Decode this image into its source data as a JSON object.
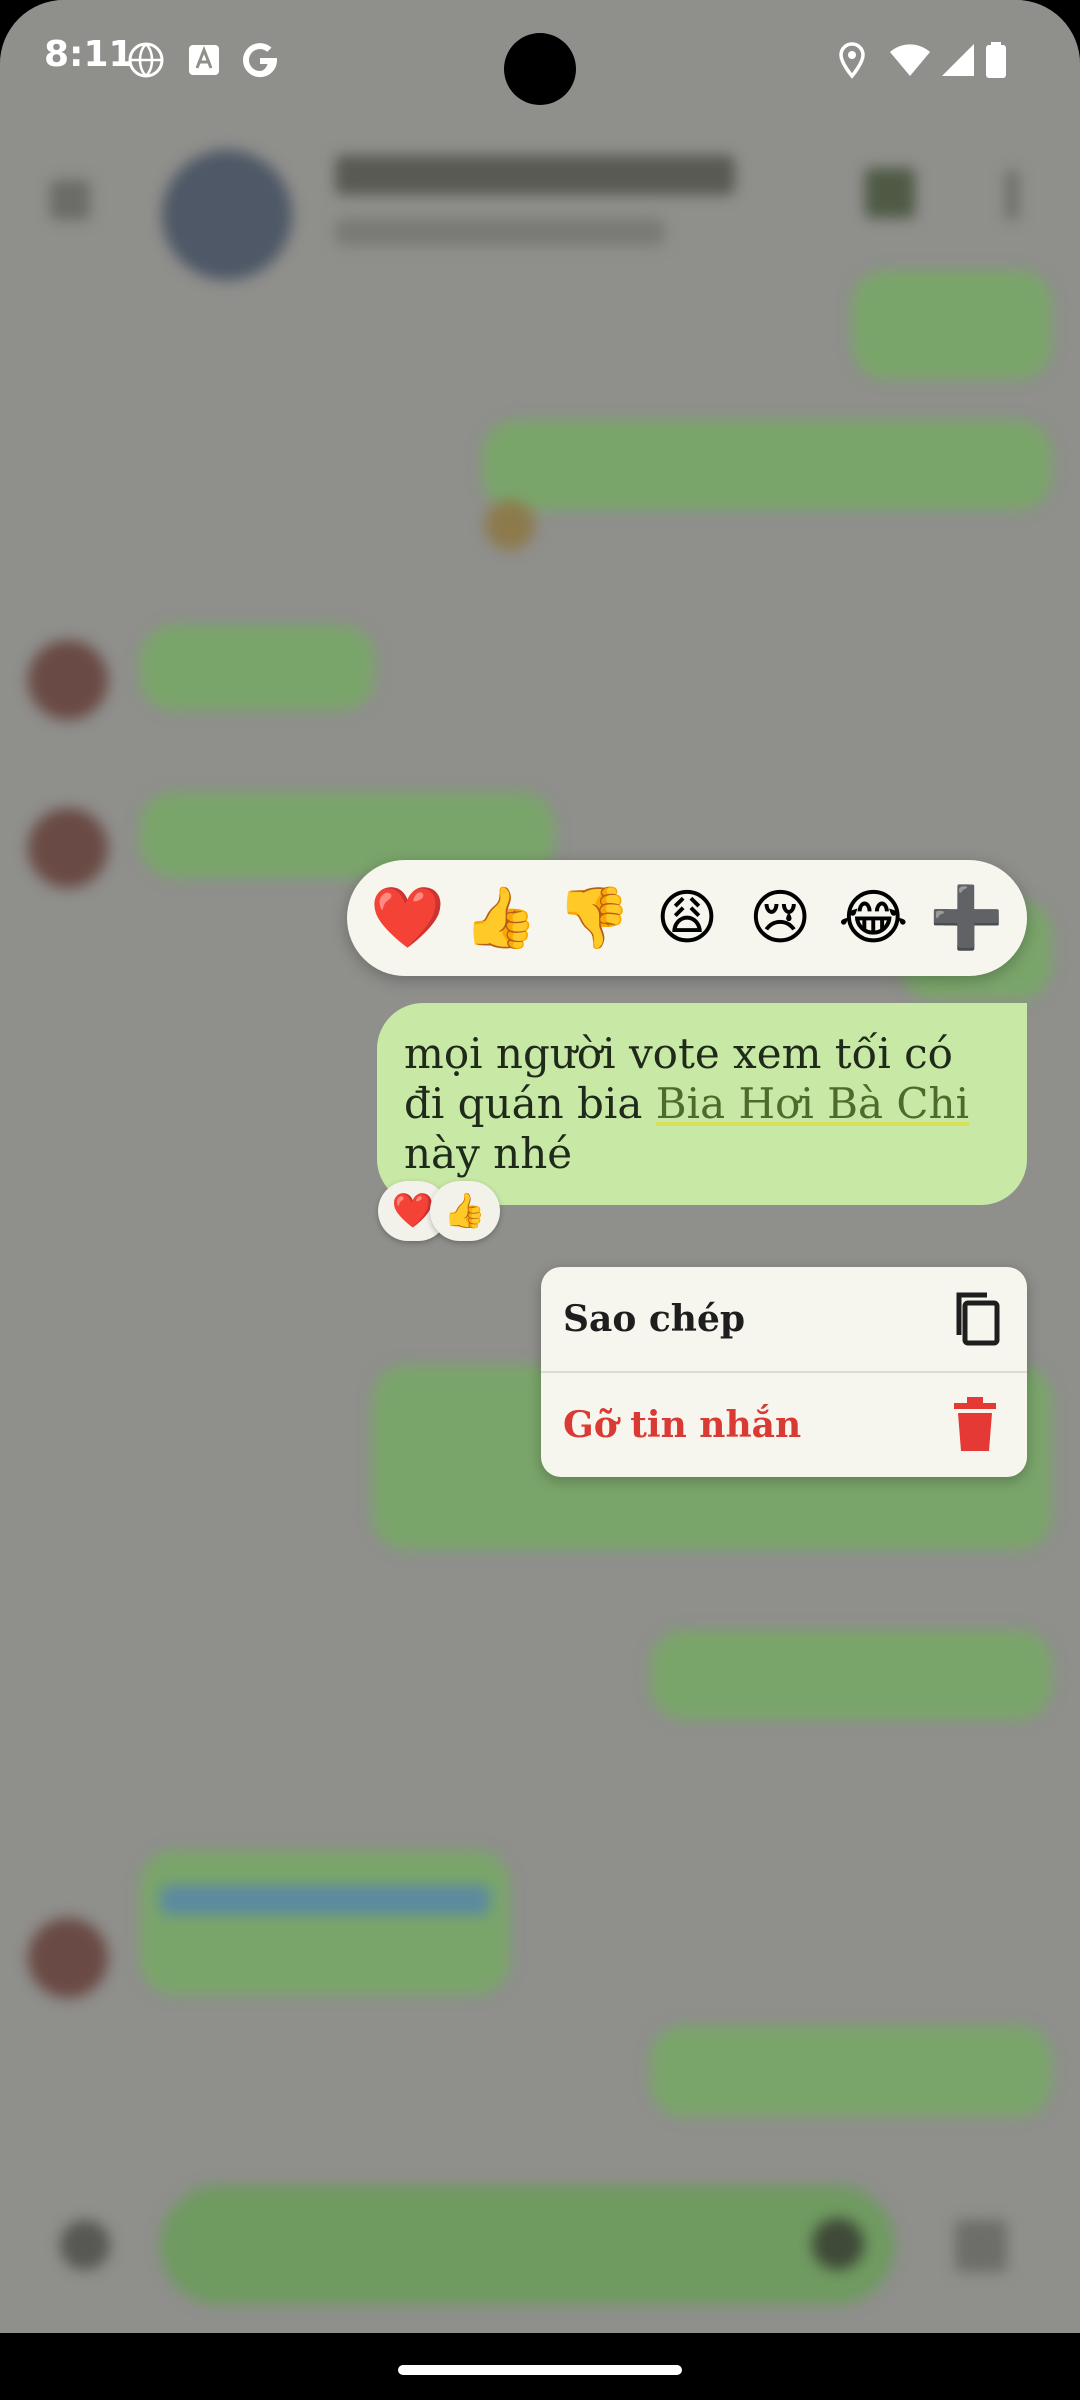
{
  "status_bar": {
    "time": "8:11",
    "left_icons": [
      "globe-icon",
      "translate-a-icon",
      "google-g-icon"
    ],
    "right_icons": [
      "location-icon",
      "wifi-icon",
      "signal-icon",
      "battery-icon"
    ]
  },
  "reactions": [
    {
      "name": "heart",
      "emoji": "❤️"
    },
    {
      "name": "thumbs-up",
      "emoji": "👍"
    },
    {
      "name": "thumbs-down",
      "emoji": "👎"
    },
    {
      "name": "weary",
      "emoji": "😩"
    },
    {
      "name": "crying",
      "emoji": "😢"
    },
    {
      "name": "joy",
      "emoji": "😂"
    },
    {
      "name": "more",
      "emoji": "➕"
    }
  ],
  "message": {
    "text_before": "mọi người vote xem tối có đi quán bia ",
    "link_text": "Bia Hơi Bà Chi",
    "text_after": " này nhé",
    "bubble_color": "#c8e8a6",
    "reactions": [
      "❤️",
      "👍"
    ]
  },
  "context_menu": {
    "copy_label": "Sao chép",
    "unsend_label": "Gỡ tin nhắn",
    "destructive_color": "#d93a33"
  }
}
